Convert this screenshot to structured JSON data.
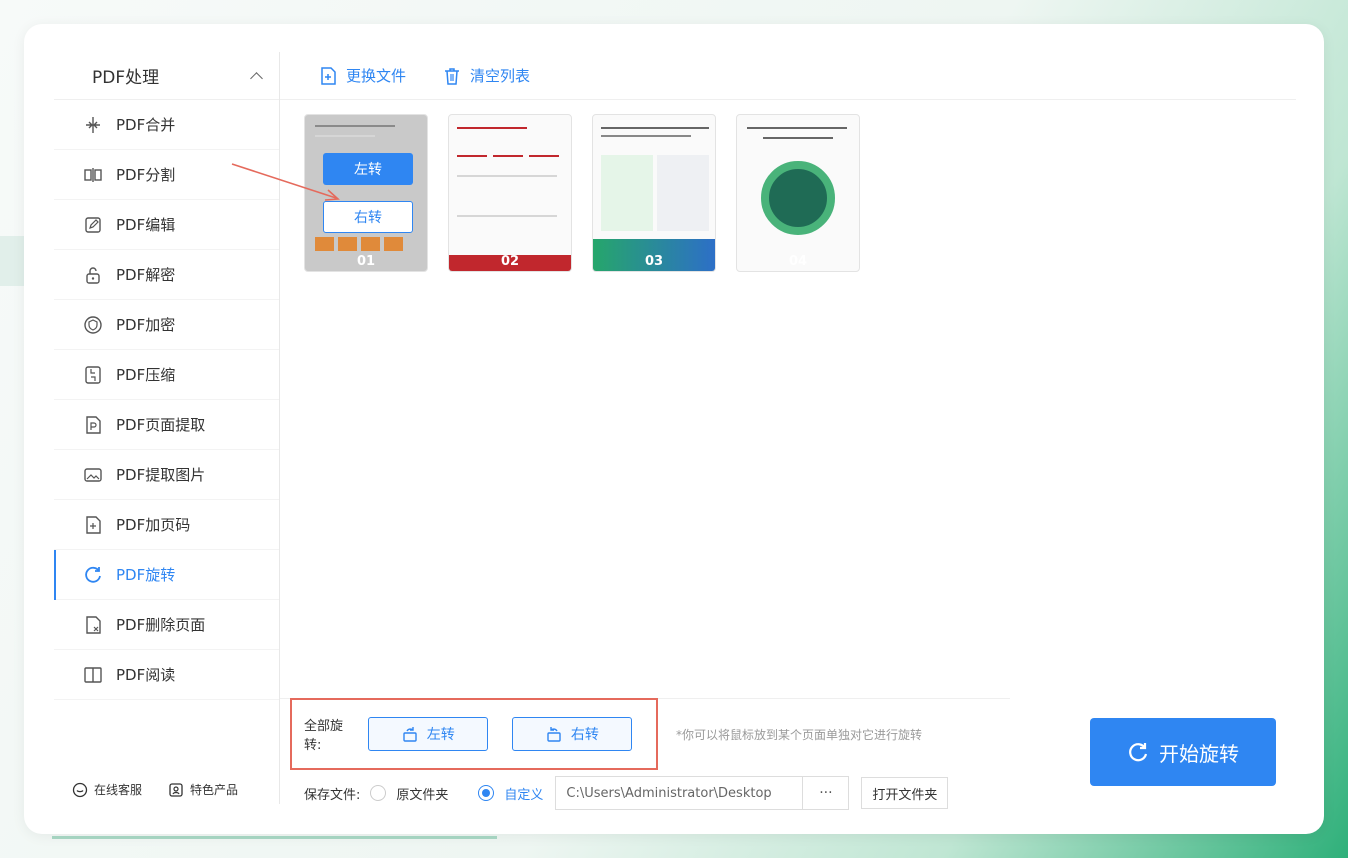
{
  "sidebar": {
    "title": "PDF处理",
    "items": [
      {
        "label": "PDF合并",
        "icon": "merge-icon"
      },
      {
        "label": "PDF分割",
        "icon": "split-icon"
      },
      {
        "label": "PDF编辑",
        "icon": "edit-icon"
      },
      {
        "label": "PDF解密",
        "icon": "unlock-icon"
      },
      {
        "label": "PDF加密",
        "icon": "shield-icon"
      },
      {
        "label": "PDF压缩",
        "icon": "compress-icon"
      },
      {
        "label": "PDF页面提取",
        "icon": "page-extract-icon"
      },
      {
        "label": "PDF提取图片",
        "icon": "image-icon"
      },
      {
        "label": "PDF加页码",
        "icon": "page-number-icon"
      },
      {
        "label": "PDF旋转",
        "icon": "rotate-icon",
        "active": true
      },
      {
        "label": "PDF删除页面",
        "icon": "delete-page-icon"
      },
      {
        "label": "PDF阅读",
        "icon": "book-icon"
      }
    ],
    "footer": {
      "service": "在线客服",
      "products": "特色产品"
    }
  },
  "toolbar": {
    "replace_file": "更换文件",
    "clear_list": "清空列表"
  },
  "thumbnails": [
    {
      "number": "01",
      "rotate_left": "左转",
      "rotate_right": "右转"
    },
    {
      "number": "02"
    },
    {
      "number": "03"
    },
    {
      "number": "04"
    }
  ],
  "rotate_all": {
    "label": "全部旋转:",
    "left": "左转",
    "right": "右转"
  },
  "hint": "*你可以将鼠标放到某个页面单独对它进行旋转",
  "save": {
    "label": "保存文件:",
    "option_original": "原文件夹",
    "option_custom": "自定义",
    "path": "C:\\Users\\Administrator\\Desktop",
    "browse": "···",
    "open_folder": "打开文件夹"
  },
  "start_button": "开始旋转",
  "colors": {
    "accent": "#2f86f2",
    "highlight": "#e56a5c"
  }
}
